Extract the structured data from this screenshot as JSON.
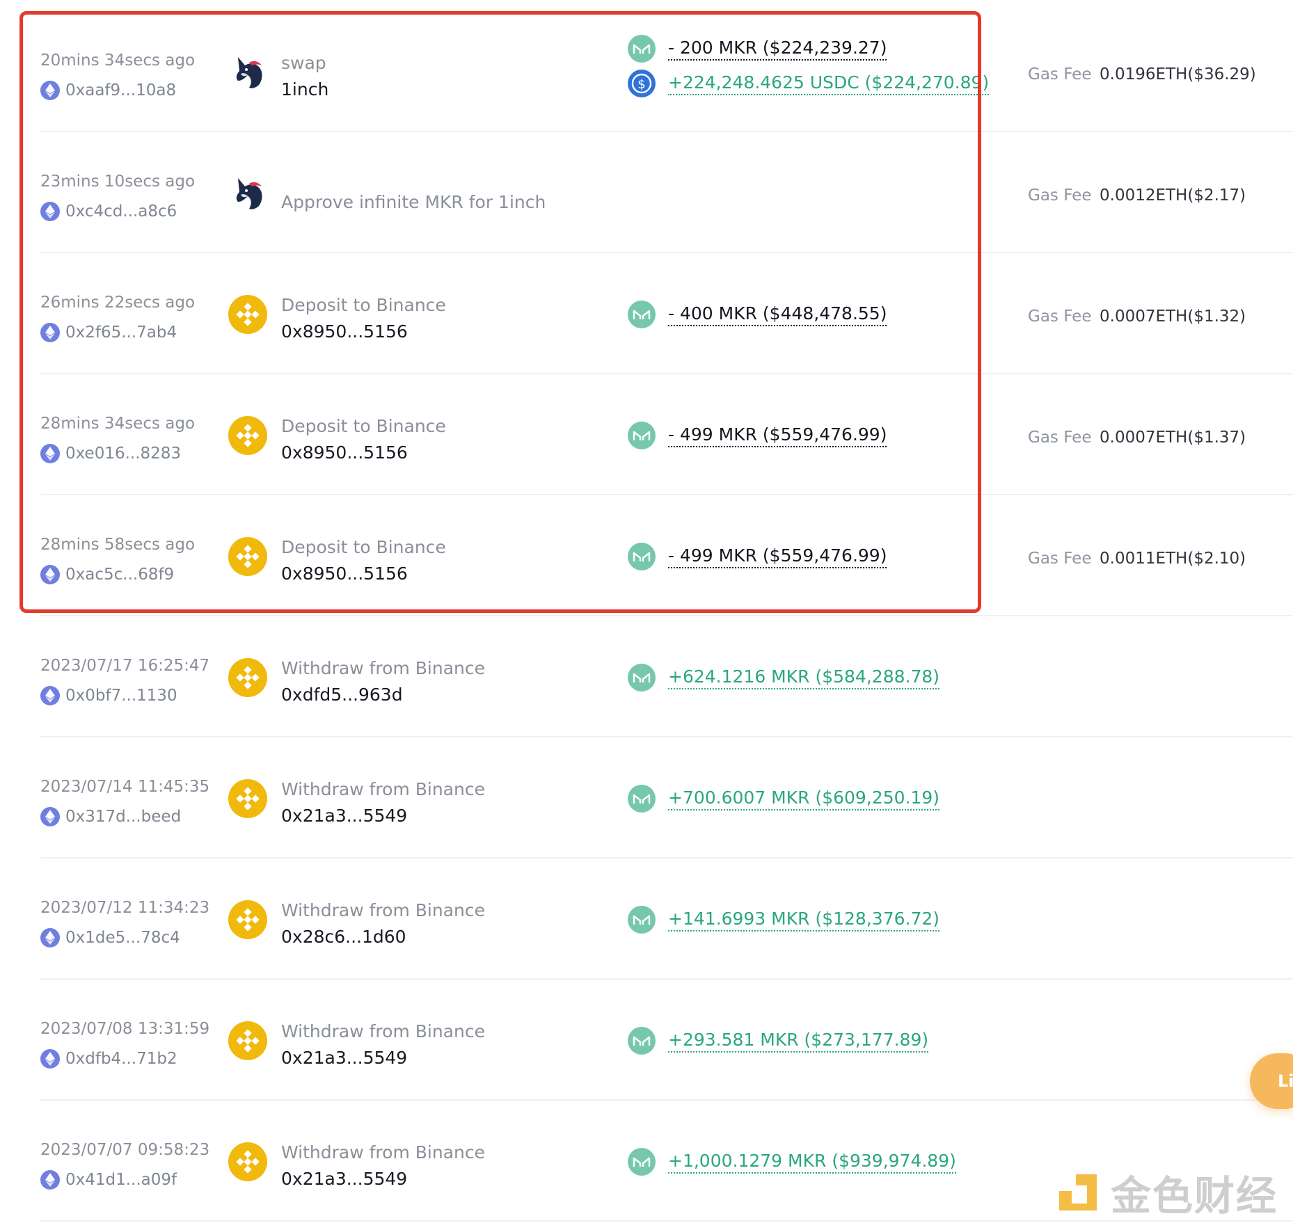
{
  "colors": {
    "highlight": "#e23a2e",
    "positive": "#2aa77e",
    "mkr_icon": "#77c7ae",
    "bnb_icon": "#f0b90b",
    "eth_icon": "#6f7fe0",
    "usdc_icon": "#2f73d8"
  },
  "gas_label": "Gas Fee",
  "floating_button": "Li",
  "watermark": "金色财经",
  "transactions": [
    {
      "time": "20mins 34secs ago",
      "hash": "0xaaf9...10a8",
      "protocol_icon": "unicorn-icon",
      "action": "swap",
      "target": "1inch",
      "amounts": [
        {
          "text": "- 200 MKR ($224,239.27)",
          "token": "mkr-icon",
          "direction": "out"
        },
        {
          "text": "+224,248.4625 USDC ($224,270.89)",
          "token": "usdc-icon",
          "direction": "in"
        }
      ],
      "gas_fee": "0.0196ETH($36.29)"
    },
    {
      "time": "23mins 10secs ago",
      "hash": "0xc4cd...a8c6",
      "protocol_icon": "unicorn-icon",
      "action": "Approve infinite MKR for 1inch",
      "target": "",
      "amounts": [],
      "gas_fee": "0.0012ETH($2.17)"
    },
    {
      "time": "26mins 22secs ago",
      "hash": "0x2f65...7ab4",
      "protocol_icon": "binance-icon",
      "action": "Deposit to Binance",
      "target": "0x8950...5156",
      "amounts": [
        {
          "text": "- 400 MKR ($448,478.55)",
          "token": "mkr-icon",
          "direction": "out"
        }
      ],
      "gas_fee": "0.0007ETH($1.32)"
    },
    {
      "time": "28mins 34secs ago",
      "hash": "0xe016...8283",
      "protocol_icon": "binance-icon",
      "action": "Deposit to Binance",
      "target": "0x8950...5156",
      "amounts": [
        {
          "text": "- 499 MKR ($559,476.99)",
          "token": "mkr-icon",
          "direction": "out"
        }
      ],
      "gas_fee": "0.0007ETH($1.37)"
    },
    {
      "time": "28mins 58secs ago",
      "hash": "0xac5c...68f9",
      "protocol_icon": "binance-icon",
      "action": "Deposit to Binance",
      "target": "0x8950...5156",
      "amounts": [
        {
          "text": "- 499 MKR ($559,476.99)",
          "token": "mkr-icon",
          "direction": "out"
        }
      ],
      "gas_fee": "0.0011ETH($2.10)"
    },
    {
      "time": "2023/07/17 16:25:47",
      "hash": "0x0bf7...1130",
      "protocol_icon": "binance-icon",
      "action": "Withdraw from Binance",
      "target": "0xdfd5...963d",
      "amounts": [
        {
          "text": "+624.1216 MKR ($584,288.78)",
          "token": "mkr-icon",
          "direction": "in"
        }
      ],
      "gas_fee": ""
    },
    {
      "time": "2023/07/14 11:45:35",
      "hash": "0x317d...beed",
      "protocol_icon": "binance-icon",
      "action": "Withdraw from Binance",
      "target": "0x21a3...5549",
      "amounts": [
        {
          "text": "+700.6007 MKR ($609,250.19)",
          "token": "mkr-icon",
          "direction": "in"
        }
      ],
      "gas_fee": ""
    },
    {
      "time": "2023/07/12 11:34:23",
      "hash": "0x1de5...78c4",
      "protocol_icon": "binance-icon",
      "action": "Withdraw from Binance",
      "target": "0x28c6...1d60",
      "amounts": [
        {
          "text": "+141.6993 MKR ($128,376.72)",
          "token": "mkr-icon",
          "direction": "in"
        }
      ],
      "gas_fee": ""
    },
    {
      "time": "2023/07/08 13:31:59",
      "hash": "0xdfb4...71b2",
      "protocol_icon": "binance-icon",
      "action": "Withdraw from Binance",
      "target": "0x21a3...5549",
      "amounts": [
        {
          "text": "+293.581 MKR ($273,177.89)",
          "token": "mkr-icon",
          "direction": "in"
        }
      ],
      "gas_fee": ""
    },
    {
      "time": "2023/07/07 09:58:23",
      "hash": "0x41d1...a09f",
      "protocol_icon": "binance-icon",
      "action": "Withdraw from Binance",
      "target": "0x21a3...5549",
      "amounts": [
        {
          "text": "+1,000.1279 MKR ($939,974.89)",
          "token": "mkr-icon",
          "direction": "in"
        }
      ],
      "gas_fee": ""
    }
  ]
}
